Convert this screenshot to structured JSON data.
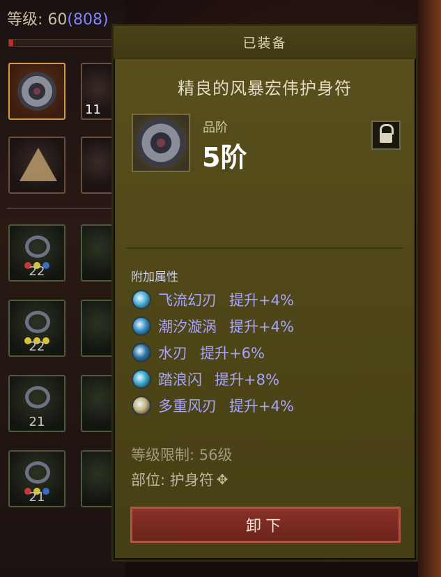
{
  "player": {
    "level_label": "等级: ",
    "level_value": "60",
    "paragon": "(808)",
    "xp_progress": 0.04
  },
  "inventory": {
    "slots": [
      {
        "level": "11"
      },
      {
        "level": "22"
      },
      {
        "level": "22"
      },
      {
        "level": "21"
      },
      {
        "level": "21"
      }
    ]
  },
  "tooltip": {
    "header": "已装备",
    "item_name": "精良的风暴宏伟护身符",
    "grade_label": "品阶",
    "grade_value": "5阶",
    "attributes_title": "附加属性",
    "attributes": [
      {
        "name": "飞流幻刃",
        "value": "提升+4%",
        "icon": "blade-swirl-icon",
        "color": "#4fb0d6"
      },
      {
        "name": "潮汐漩涡",
        "value": "提升+4%",
        "icon": "tide-vortex-icon",
        "color": "#3a8fc2"
      },
      {
        "name": "水刃",
        "value": "提升+6%",
        "icon": "water-blade-icon",
        "color": "#2f77a6"
      },
      {
        "name": "踏浪闪",
        "value": "提升+8%",
        "icon": "wave-dash-icon",
        "color": "#3aa9c9"
      },
      {
        "name": "多重风刃",
        "value": "提升+4%",
        "icon": "wind-blade-icon",
        "color": "#c9b17a"
      }
    ],
    "level_requirement": "等级限制: 56级",
    "slot_label": "部位: 护身符",
    "unequip_button": "卸下"
  },
  "colors": {
    "panel": "#524a1a",
    "attribute_text": "#a7a4ff",
    "button": "#7a2a22"
  }
}
